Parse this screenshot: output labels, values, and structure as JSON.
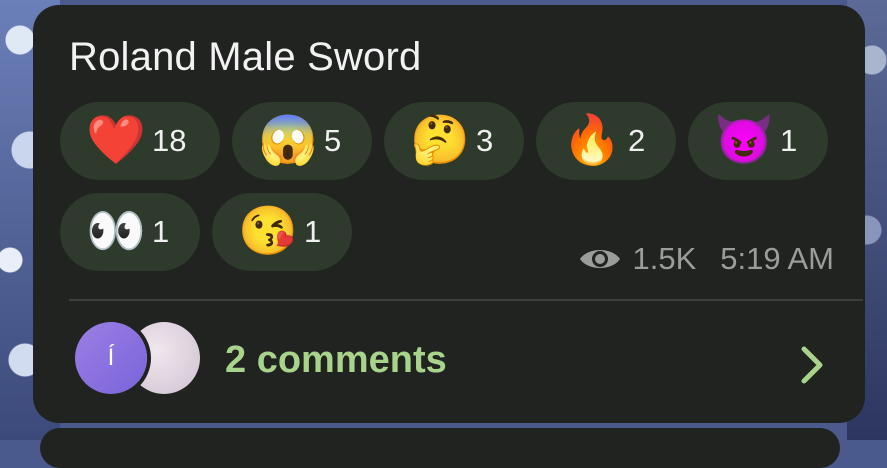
{
  "post": {
    "title": "Roland Male Sword"
  },
  "reactions": [
    {
      "emoji": "❤️",
      "count": "18",
      "icon": "heart-icon"
    },
    {
      "emoji": "😱",
      "count": "5",
      "icon": "screaming-face-icon"
    },
    {
      "emoji": "🤔",
      "count": "3",
      "icon": "thinking-face-icon"
    },
    {
      "emoji": "🔥",
      "count": "2",
      "icon": "fire-icon"
    },
    {
      "emoji": "😈",
      "count": "1",
      "icon": "smiling-devil-icon"
    },
    {
      "emoji": "👀",
      "count": "1",
      "icon": "eyes-icon"
    },
    {
      "emoji": "😘",
      "count": "1",
      "icon": "kiss-face-icon"
    }
  ],
  "meta": {
    "views": "1.5K",
    "time": "5:19 AM"
  },
  "comments": {
    "avatar_initial": "Í",
    "label": "2 comments"
  },
  "colors": {
    "card_bg": "#202320",
    "reaction_bg": "#2e3a2b",
    "accent_green": "#a8d38a"
  }
}
